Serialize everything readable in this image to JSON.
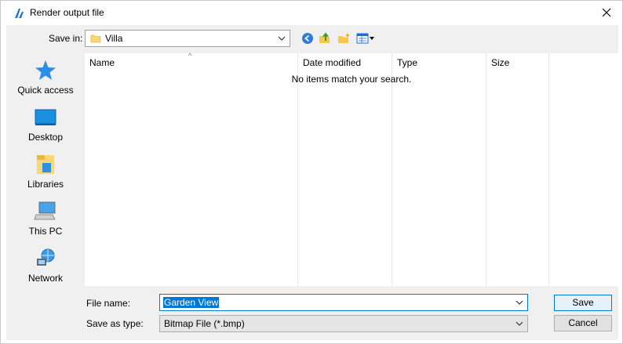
{
  "window": {
    "title": "Render output file"
  },
  "toolbar": {
    "save_in_label": "Save in:",
    "save_in_value": "Villa"
  },
  "places": [
    {
      "label": "Quick access",
      "icon": "star-icon"
    },
    {
      "label": "Desktop",
      "icon": "desktop-icon"
    },
    {
      "label": "Libraries",
      "icon": "libraries-icon"
    },
    {
      "label": "This PC",
      "icon": "computer-icon"
    },
    {
      "label": "Network",
      "icon": "network-icon"
    }
  ],
  "filelist": {
    "columns": [
      "Name",
      "Date modified",
      "Type",
      "Size"
    ],
    "empty_message": "No items match your search."
  },
  "form": {
    "file_name_label": "File name:",
    "file_name_value": "Garden View",
    "save_as_type_label": "Save as type:",
    "save_as_type_value": "Bitmap File (*.bmp)"
  },
  "buttons": {
    "save": "Save",
    "cancel": "Cancel"
  },
  "colors": {
    "accent": "#0078d7",
    "dialog_bg": "#f0f0f0"
  }
}
